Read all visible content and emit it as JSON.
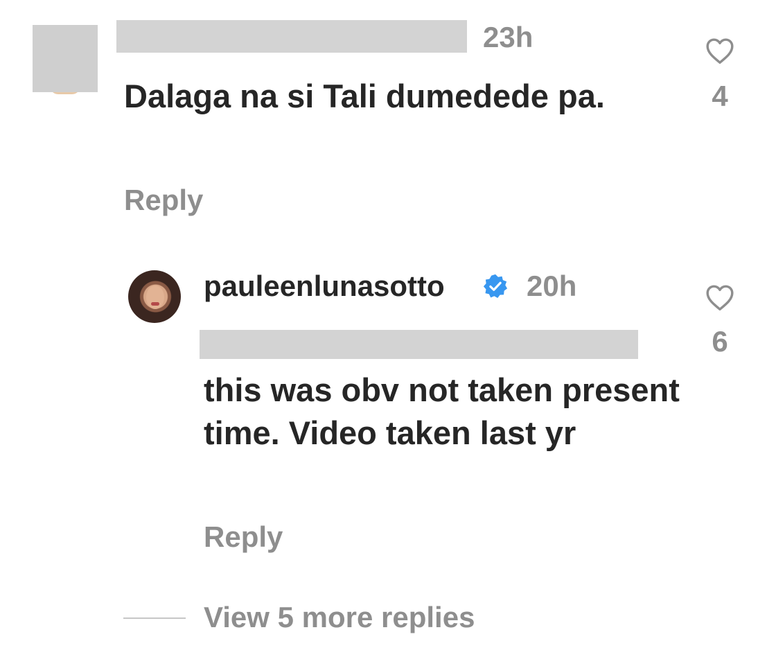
{
  "comment": {
    "time": "23h",
    "text": "Dalaga na si Tali dumedede pa.",
    "reply_label": "Reply",
    "like_count": "4"
  },
  "reply": {
    "username": "pauleenlunasotto",
    "verified": true,
    "time": "20h",
    "text": "this was obv not taken present time. Video taken last yr",
    "reply_label": "Reply",
    "like_count": "6"
  },
  "view_more": {
    "label": "View 5 more replies"
  },
  "icons": {
    "like": "heart-outline-icon",
    "verified": "verified-badge-icon"
  },
  "colors": {
    "text_primary": "#262626",
    "text_secondary": "#8e8e8e",
    "verified_blue": "#3897f0",
    "redaction_gray": "#d3d3d3"
  }
}
